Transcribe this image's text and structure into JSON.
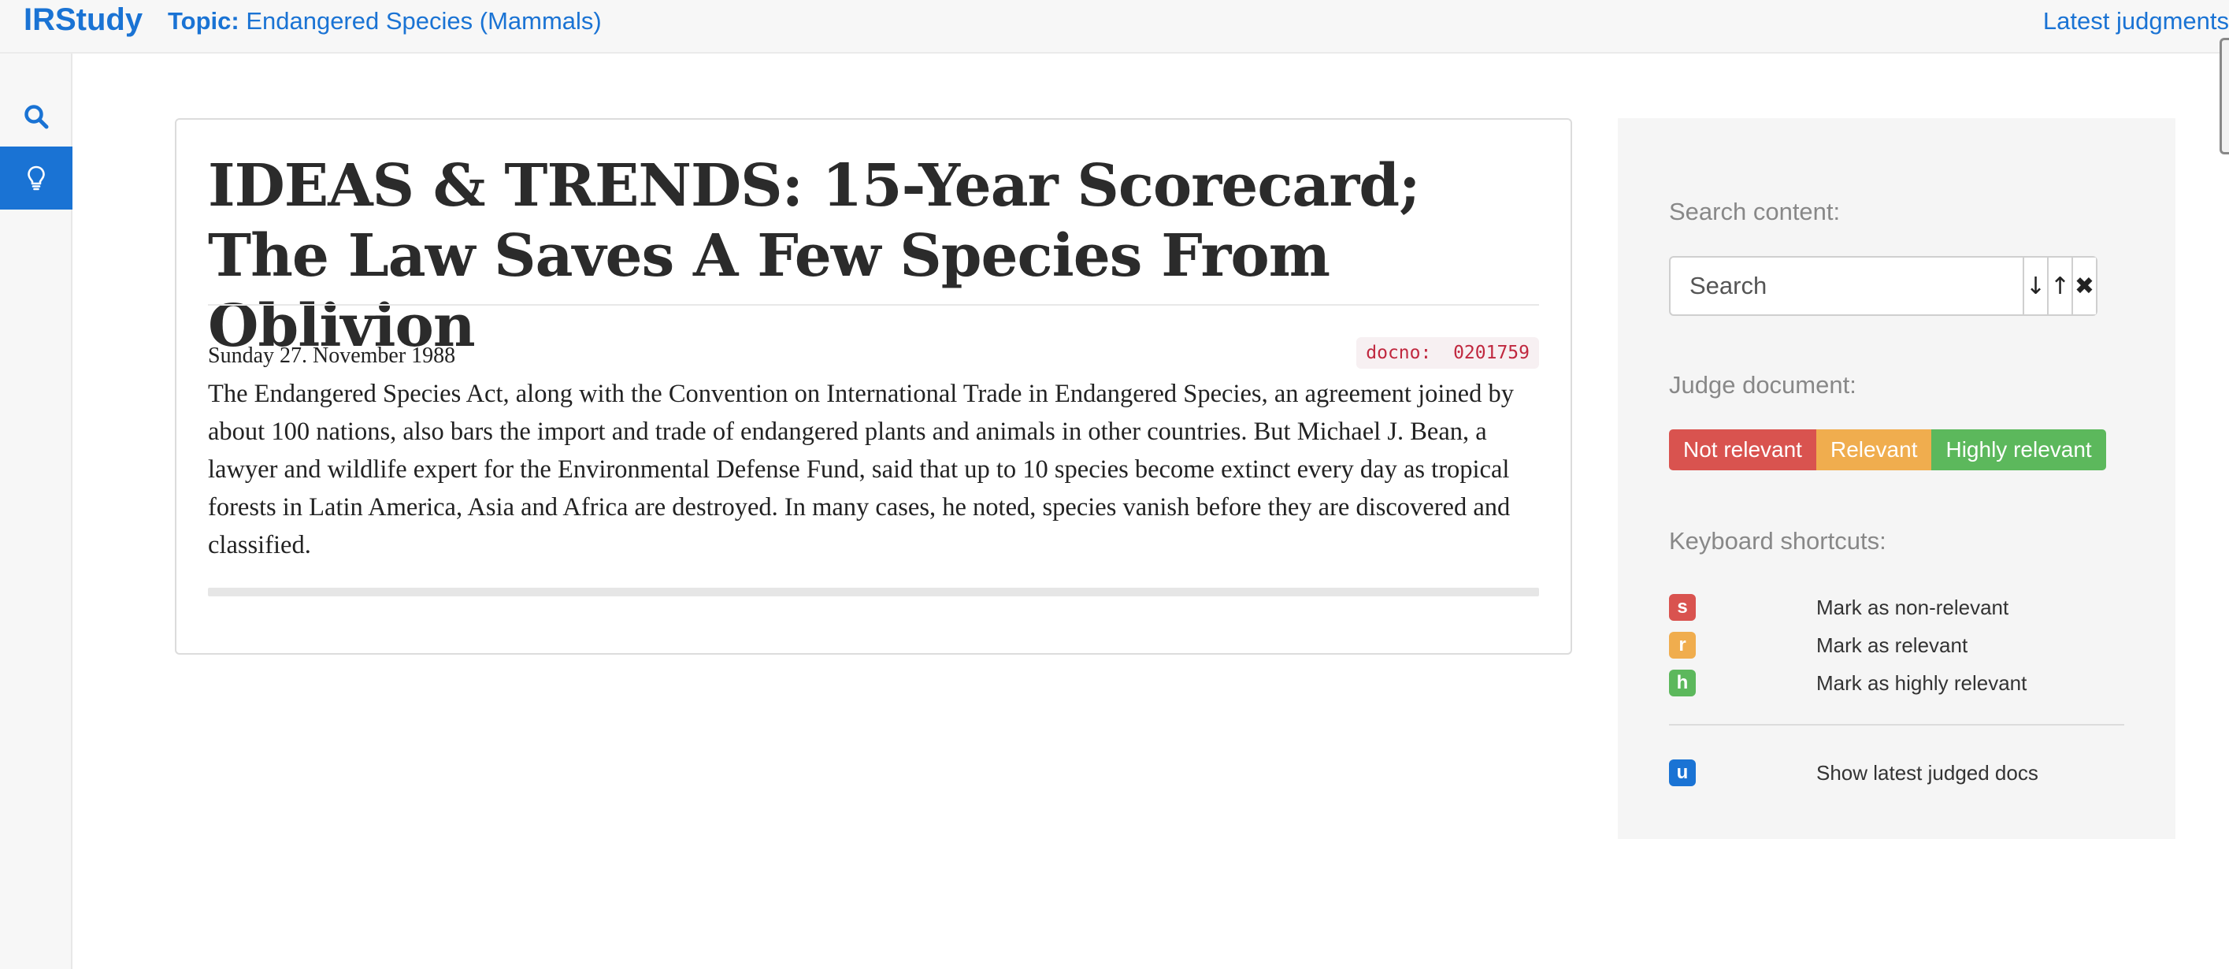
{
  "nav": {
    "brand": "IRStudy",
    "topic_label": "Topic:",
    "topic_value": "Endangered Species (Mammals)",
    "latest_link": "Latest judgments"
  },
  "sidebar": {
    "items": [
      {
        "icon": "search-icon",
        "active": false
      },
      {
        "icon": "lightbulb-icon",
        "active": true
      }
    ]
  },
  "document": {
    "title": "IDEAS & TRENDS: 15-Year Scorecard; The Law Saves A Few Species From Oblivion",
    "date": "Sunday 27. November 1988",
    "docno_label": "docno:",
    "docno_value": "0201759",
    "body": "The Endangered Species Act, along with the Convention on International Trade in Endangered Species, an agreement joined by about 100 nations, also bars the import and trade of endangered plants and animals in other countries. But Michael J. Bean, a lawyer and wildlife expert for the Environmental Defense Fund, said that up to 10 species become extinct every day as tropical forests in Latin America, Asia and Africa are destroyed. In many cases, he noted, species vanish before they are discovered and classified.",
    "read_progress": 0
  },
  "panel": {
    "search_heading": "Search content:",
    "search_placeholder": "Search",
    "search_value": "",
    "search_next_glyph": "↓",
    "search_prev_glyph": "↑",
    "search_clear_glyph": "✖",
    "judge_heading": "Judge document:",
    "judge_buttons": {
      "not_relevant": "Not relevant",
      "relevant": "Relevant",
      "highly_relevant": "Highly relevant"
    },
    "shortcuts_heading": "Keyboard shortcuts:",
    "shortcuts": [
      {
        "key": "s",
        "label": "Mark as non-relevant",
        "color": "#d9534f"
      },
      {
        "key": "r",
        "label": "Mark as relevant",
        "color": "#f0ad4e"
      },
      {
        "key": "h",
        "label": "Mark as highly relevant",
        "color": "#5cb85c"
      },
      {
        "key": "u",
        "label": "Show latest judged docs",
        "color": "#1a73d4"
      }
    ]
  },
  "colors": {
    "accent": "#1a73d4",
    "not_relevant": "#d9534f",
    "relevant": "#f0ad4e",
    "highly_relevant": "#5cb85c"
  }
}
